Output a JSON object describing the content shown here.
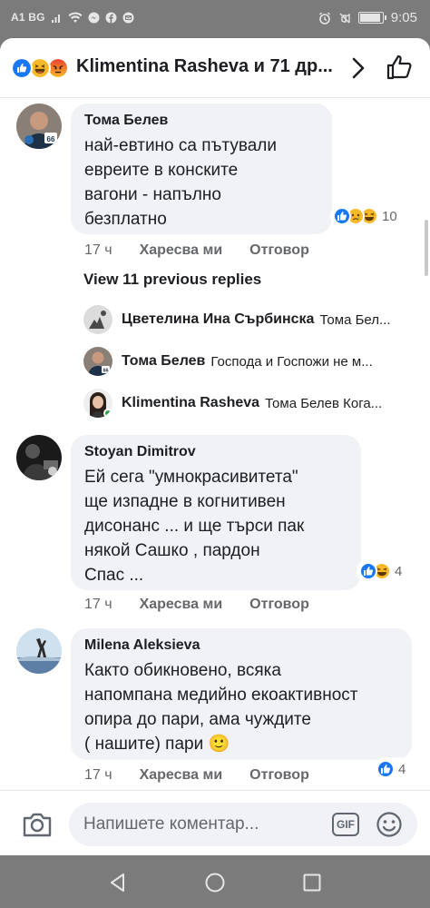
{
  "status_bar": {
    "carrier": "A1 BG",
    "time": "9:05"
  },
  "header": {
    "title": "Klimentina Rasheva и 71 др...",
    "reactions": [
      "like",
      "haha",
      "angry"
    ]
  },
  "comments": [
    {
      "author": "Тома Белев",
      "lines": [
        "най-евтино са пътували",
        "евреите в конските",
        "вагони - напълно",
        "безплатно"
      ],
      "reactions": [
        "like",
        "sad",
        "haha"
      ],
      "reaction_count": "10",
      "time": "17 ч",
      "like_label": "Харесва ми",
      "reply_label": "Отговор"
    },
    {
      "author": "Stoyan Dimitrov",
      "lines": [
        "Ей сега \"умнокрасивитета\"",
        "ще изпадне в когнитивен",
        "дисонанс ... и ще търси пак",
        "някой Сашко , пардон",
        "Спас ..."
      ],
      "reactions": [
        "like",
        "haha"
      ],
      "reaction_count": "4",
      "time": "17 ч",
      "like_label": "Харесва ми",
      "reply_label": "Отговор"
    },
    {
      "author": "Milena Aleksieva",
      "lines": [
        "Както обикновено, всяка",
        "напомпана медийно екоактивност",
        "опира до пари, ама чуждите",
        "( нашите) пари 🙂"
      ],
      "reactions": [
        "like"
      ],
      "reaction_count": "4",
      "time": "17 ч",
      "like_label": "Харесва ми",
      "reply_label": "Отговор"
    }
  ],
  "replies": {
    "view_previous": "View 11 previous replies",
    "items": [
      {
        "name": "Цветелина Ина Сърбинска",
        "text": "Тома Бел..."
      },
      {
        "name": "Тома Белев",
        "text": "Господа и Госпожи не м..."
      },
      {
        "name": "Klimentina Rasheva",
        "text": "Тома Белев Кога..."
      }
    ]
  },
  "composer": {
    "placeholder": "Напишете коментар...",
    "gif_label": "GIF"
  },
  "colors": {
    "like": "#1877f2",
    "haha": "#f7b928",
    "angry": "#e9710f",
    "bubble": "#f0f2f5",
    "meta": "#65676b"
  },
  "icons": [
    "wifi-icon",
    "chevron-right-icon",
    "like-outline-icon",
    "camera-icon",
    "emoji-icon",
    "nav-back-icon",
    "nav-home-icon",
    "nav-recents-icon"
  ]
}
